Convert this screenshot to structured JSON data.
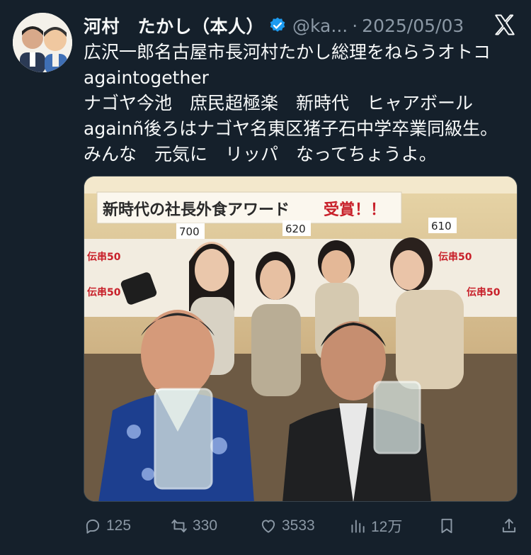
{
  "tweet": {
    "display_name": "河村　たかし（本人）",
    "handle": "@ka...",
    "separator": "·",
    "date": "2025/05/03",
    "text_lines": [
      "広沢一郎名古屋市長河村たかし総理をねらうオトコ",
      "againtogether",
      "ナゴヤ今池　庶民超極楽　新時代　ヒャアボール",
      "againñ後ろはナゴヤ名東区猪子石中学卒業同級生。",
      "みんな　元気に　リッパ　なってちょうよ。"
    ]
  },
  "photo": {
    "banner_text": "新時代の社長外食アワード",
    "banner_accent": "受賞！！",
    "price_tags": [
      "700",
      "620",
      "610"
    ],
    "poster_text": "伝串50"
  },
  "actions": {
    "replies": "125",
    "reposts": "330",
    "likes": "3533",
    "views": "12万"
  },
  "colors": {
    "background": "#15202b",
    "text": "#f7f9f9",
    "muted": "#8b98a5",
    "verified": "#1d9bf0"
  },
  "icons": {
    "verified": "verified-badge-icon",
    "brand": "x-logo-icon",
    "reply": "reply-icon",
    "repost": "repost-icon",
    "like": "heart-icon",
    "views": "views-icon",
    "bookmark": "bookmark-icon",
    "share": "share-icon"
  }
}
